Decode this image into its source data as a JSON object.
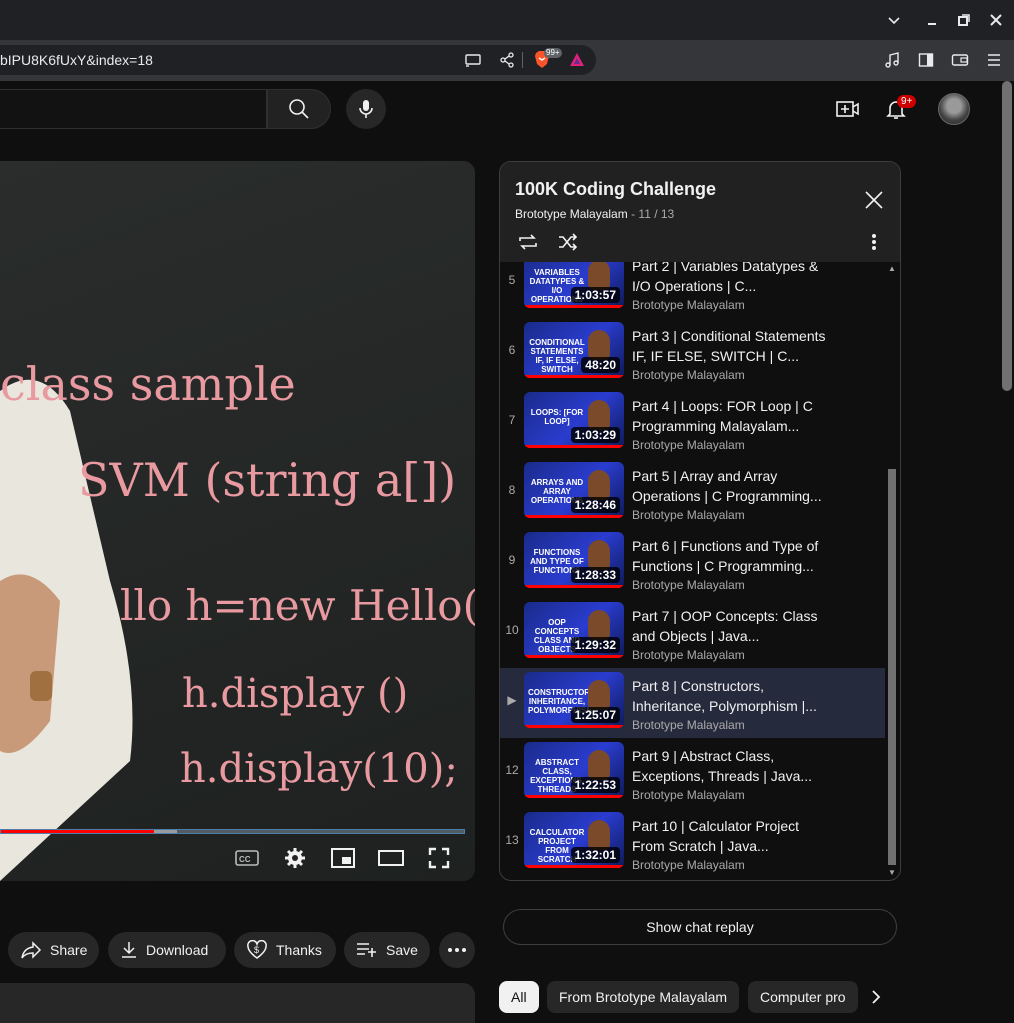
{
  "browser": {
    "url": "bIPU8K6fUxY&index=18",
    "brave_badge": "99+"
  },
  "header": {
    "notifications_count": "9+"
  },
  "video": {
    "chalk_lines": [
      "class sample",
      "SVM (string a[])",
      "llo  h=new Hello();",
      "h.display ()",
      "h.display(10);"
    ],
    "progress_fraction": 0.33,
    "buffer_start_fraction": 0.33,
    "buffer_end_fraction": 0.38,
    "controls": [
      "cc-icon",
      "settings-icon",
      "miniplayer-icon",
      "theater-icon",
      "fullscreen-icon"
    ]
  },
  "playlist": {
    "title": "100K Coding Challenge",
    "channel": "Brototype Malayalam",
    "position": "11 / 13",
    "items": [
      {
        "index": "5",
        "title": "Part 2 | Variables Datatypes & I/O Operations | C...",
        "channel": "Brototype Malayalam",
        "duration": "1:03:57",
        "thumb": "VARIABLES DATATYPES & I/O OPERATIONS",
        "active": false
      },
      {
        "index": "6",
        "title": "Part 3 | Conditional Statements IF, IF ELSE, SWITCH | C...",
        "channel": "Brototype Malayalam",
        "duration": "48:20",
        "thumb": "CONDITIONAL STATEMENTS IF, IF ELSE, SWITCH",
        "active": false
      },
      {
        "index": "7",
        "title": "Part 4 | Loops: FOR Loop | C Programming Malayalam...",
        "channel": "Brototype Malayalam",
        "duration": "1:03:29",
        "thumb": "LOOPS: [FOR LOOP]",
        "active": false
      },
      {
        "index": "8",
        "title": "Part 5 | Array and Array Operations | C Programming...",
        "channel": "Brototype Malayalam",
        "duration": "1:28:46",
        "thumb": "ARRAYS AND ARRAY OPERATIONS",
        "active": false
      },
      {
        "index": "9",
        "title": "Part 6 | Functions and Type of Functions | C Programming...",
        "channel": "Brototype Malayalam",
        "duration": "1:28:33",
        "thumb": "FUNCTIONS AND TYPE OF FUNCTIONS",
        "active": false
      },
      {
        "index": "10",
        "title": "Part 7 | OOP Concepts: Class and Objects | Java...",
        "channel": "Brototype Malayalam",
        "duration": "1:29:32",
        "thumb": "OOP CONCEPTS CLASS AND OBJECTS",
        "active": false
      },
      {
        "index": "▶",
        "title": "Part 8 | Constructors, Inheritance, Polymorphism |...",
        "channel": "Brototype Malayalam",
        "duration": "1:25:07",
        "thumb": "CONSTRUCTORS, INHERITANCE, POLYMORPHISM",
        "active": true
      },
      {
        "index": "12",
        "title": "Part 9 | Abstract Class, Exceptions, Threads | Java...",
        "channel": "Brototype Malayalam",
        "duration": "1:22:53",
        "thumb": "ABSTRACT CLASS, EXCEPTIONS, THREADS",
        "active": false
      },
      {
        "index": "13",
        "title": "Part 10 | Calculator Project From Scratch | Java...",
        "channel": "Brototype Malayalam",
        "duration": "1:32:01",
        "thumb": "CALCULATOR PROJECT FROM SCRATCH",
        "active": false
      }
    ]
  },
  "actions": {
    "share": "Share",
    "download": "Download",
    "thanks": "Thanks",
    "save": "Save"
  },
  "chat": {
    "show_replay": "Show chat replay"
  },
  "chips": [
    "All",
    "From Brototype Malayalam",
    "Computer pro"
  ],
  "colors": {
    "accent_red": "#ff0000",
    "active_row": "#262a3d"
  }
}
